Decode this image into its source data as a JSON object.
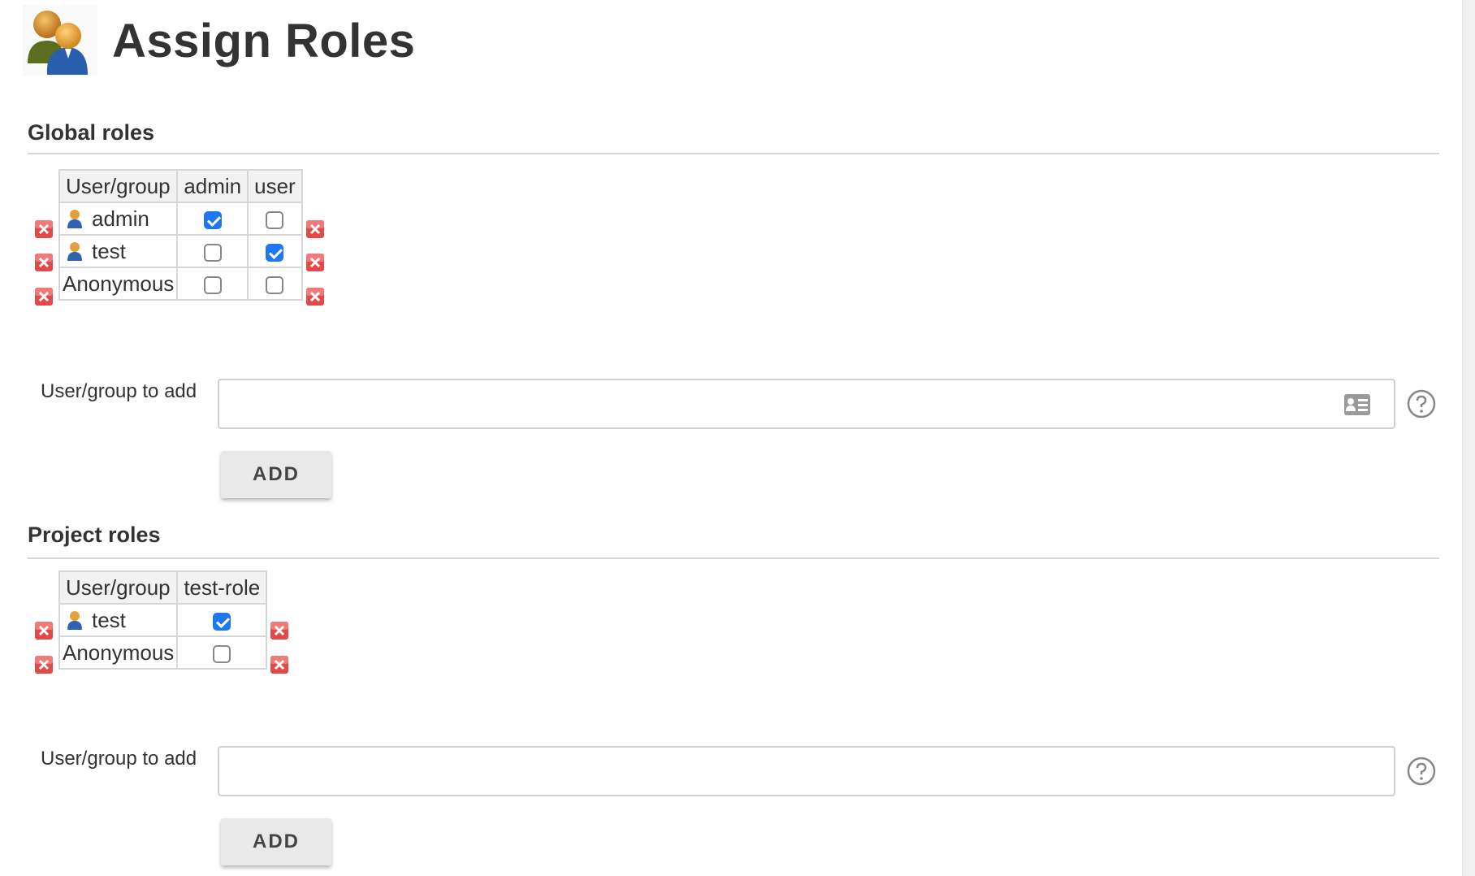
{
  "page": {
    "title": "Assign Roles"
  },
  "global_roles": {
    "title": "Global roles",
    "columns": [
      "User/group",
      "admin",
      "user"
    ],
    "rows": [
      {
        "name": "admin",
        "icon": "user-icon",
        "checks": [
          true,
          false
        ]
      },
      {
        "name": "test",
        "icon": "user-icon",
        "checks": [
          false,
          true
        ]
      },
      {
        "name": "Anonymous",
        "icon": null,
        "checks": [
          false,
          false
        ]
      }
    ],
    "add_label": "User/group to add",
    "add_value": "",
    "add_button": "ADD"
  },
  "project_roles": {
    "title": "Project roles",
    "columns": [
      "User/group",
      "test-role"
    ],
    "rows": [
      {
        "name": "test",
        "icon": "user-icon",
        "checks": [
          true
        ]
      },
      {
        "name": "Anonymous",
        "icon": null,
        "checks": [
          false
        ]
      }
    ],
    "add_label": "User/group to add",
    "add_value": "",
    "add_button": "ADD"
  },
  "colors": {
    "checkbox_checked": "#1f78f0",
    "delete_icon": "#e04848",
    "rule": "#d6d6d6"
  }
}
